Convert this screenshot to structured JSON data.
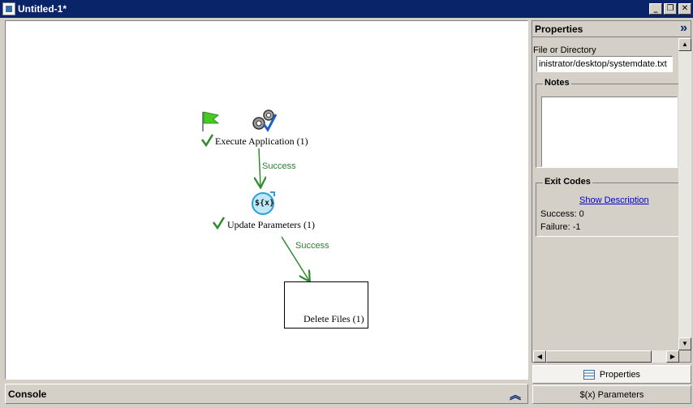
{
  "window": {
    "title": "Untitled-1*",
    "minimize": "_",
    "restore": "❐",
    "close": "✕"
  },
  "canvas": {
    "nodes": {
      "execute_label": "Execute Application (1)",
      "update_label": "Update Parameters (1)",
      "delete_label": "Delete Files (1)",
      "update_icon_text": "${x}"
    },
    "edges": {
      "edge1_label": "Success",
      "edge2_label": "Success"
    },
    "colors": {
      "edge": "#2e8b2e",
      "check": "#2e8b2e",
      "flag": "#44cc22"
    }
  },
  "console": {
    "label": "Console"
  },
  "properties": {
    "title": "Properties",
    "file_label": "File or Directory",
    "file_value": "inistrator/desktop/systemdate.txt",
    "notes_title": "Notes",
    "exit_codes_title": "Exit Codes",
    "show_description": "Show Description",
    "success_line": "Success: 0",
    "failure_line": "Failure: -1"
  },
  "tabs": {
    "properties": "Properties",
    "parameters": "$(x) Parameters"
  }
}
